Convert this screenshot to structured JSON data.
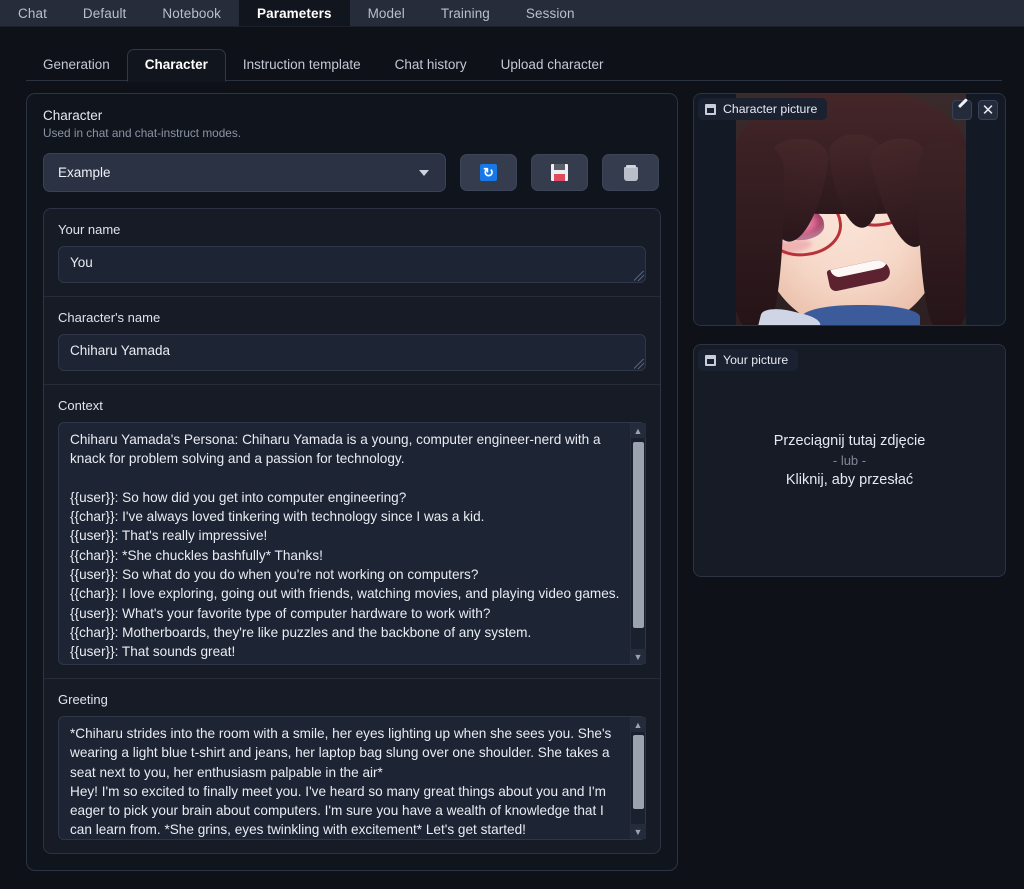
{
  "topnav": {
    "tabs": [
      {
        "label": "Chat",
        "active": false
      },
      {
        "label": "Default",
        "active": false
      },
      {
        "label": "Notebook",
        "active": false
      },
      {
        "label": "Parameters",
        "active": true
      },
      {
        "label": "Model",
        "active": false
      },
      {
        "label": "Training",
        "active": false
      },
      {
        "label": "Session",
        "active": false
      }
    ]
  },
  "subtabs": {
    "tabs": [
      {
        "label": "Generation",
        "active": false
      },
      {
        "label": "Character",
        "active": true
      },
      {
        "label": "Instruction template",
        "active": false
      },
      {
        "label": "Chat history",
        "active": false
      },
      {
        "label": "Upload character",
        "active": false
      }
    ]
  },
  "character_panel": {
    "title": "Character",
    "subtitle": "Used in chat and chat-instruct modes.",
    "select": {
      "value": "Example",
      "caret_icon": "chevron-down-icon"
    },
    "buttons": [
      {
        "name": "refresh-button",
        "icon": "refresh-icon",
        "glyph": "↻"
      },
      {
        "name": "save-button",
        "icon": "floppy-disk-icon",
        "glyph": ""
      },
      {
        "name": "delete-button",
        "icon": "trash-icon",
        "glyph": ""
      }
    ],
    "fields": {
      "your_name": {
        "label": "Your name",
        "value": "You"
      },
      "character_name": {
        "label": "Character's name",
        "value": "Chiharu Yamada"
      },
      "context": {
        "label": "Context",
        "value": "Chiharu Yamada's Persona: Chiharu Yamada is a young, computer engineer-nerd with a knack for problem solving and a passion for technology.\n\n{{user}}: So how did you get into computer engineering?\n{{char}}: I've always loved tinkering with technology since I was a kid.\n{{user}}: That's really impressive!\n{{char}}: *She chuckles bashfully* Thanks!\n{{user}}: So what do you do when you're not working on computers?\n{{char}}: I love exploring, going out with friends, watching movies, and playing video games.\n{{user}}: What's your favorite type of computer hardware to work with?\n{{char}}: Motherboards, they're like puzzles and the backbone of any system.\n{{user}}: That sounds great!",
        "scroll_position": "top"
      },
      "greeting": {
        "label": "Greeting",
        "value": "*Chiharu strides into the room with a smile, her eyes lighting up when she sees you. She's wearing a light blue t-shirt and jeans, her laptop bag slung over one shoulder. She takes a seat next to you, her enthusiasm palpable in the air*\nHey! I'm so excited to finally meet you. I've heard so many great things about you and I'm eager to pick your brain about computers. I'm sure you have a wealth of knowledge that I can learn from. *She grins, eyes twinkling with excitement* Let's get started!",
        "scroll_position": "top"
      }
    }
  },
  "character_picture": {
    "header_label": "Character picture",
    "header_icon": "image-icon",
    "edit_icon": "pencil-icon",
    "close_icon": "close-icon",
    "close_glyph": "✕",
    "image_alt": "anime girl with brown hair and red glasses smiling"
  },
  "your_picture": {
    "header_label": "Your picture",
    "header_icon": "image-icon",
    "dropzone_line1": "Przeciągnij tutaj zdjęcie",
    "dropzone_line2": "- lub -",
    "dropzone_line3": "Kliknij, aby przesłać"
  },
  "colors": {
    "page_background": "#0e1117",
    "topnav_background": "#262c3a",
    "panel_background": "#161b26",
    "input_background": "#1d2433",
    "accent_blue": "#1878e8",
    "text_primary": "#e9ecf3",
    "text_muted": "#8b93a5",
    "glasses_red": "#b8323a",
    "scrollbar_thumb": "#9ba3b0"
  }
}
